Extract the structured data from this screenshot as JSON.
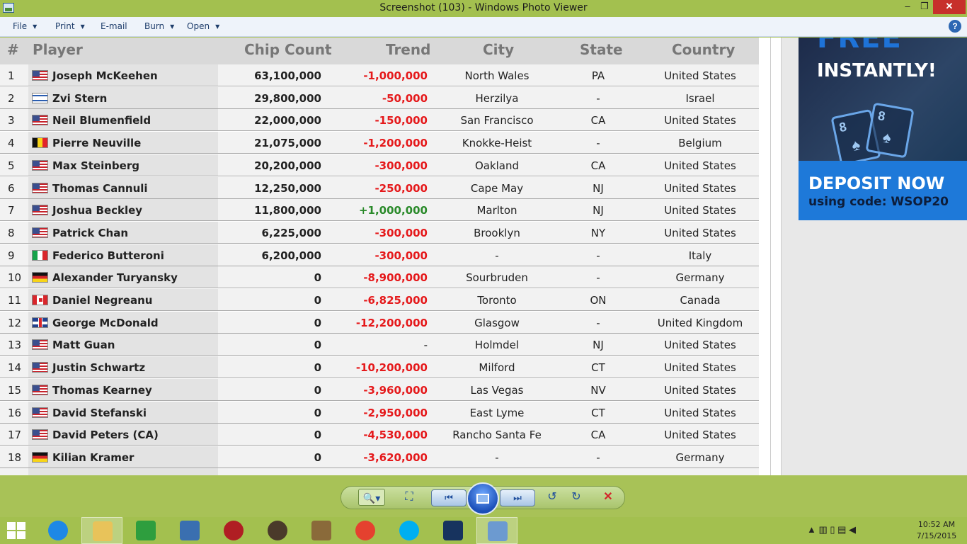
{
  "window": {
    "title": "Screenshot (103) - Windows Photo Viewer",
    "min_glyph": "–",
    "max_glyph": "❐",
    "close_glyph": "✕"
  },
  "menu": {
    "file": "File",
    "print": "Print",
    "email": "E-mail",
    "burn": "Burn",
    "open": "Open",
    "caret": "▼",
    "help": "?"
  },
  "table": {
    "headers": {
      "rank": "#",
      "player": "Player",
      "chips": "Chip Count",
      "trend": "Trend",
      "city": "City",
      "state": "State",
      "country": "Country"
    },
    "rows": [
      {
        "rank": "1",
        "flag": "us",
        "player": "Joseph McKeehen",
        "chips": "63,100,000",
        "trend": "-1,000,000",
        "trend_type": "neg",
        "city": "North Wales",
        "state": "PA",
        "country": "United States"
      },
      {
        "rank": "2",
        "flag": "il",
        "player": "Zvi Stern",
        "chips": "29,800,000",
        "trend": "-50,000",
        "trend_type": "neg",
        "city": "Herzilya",
        "state": "-",
        "country": "Israel"
      },
      {
        "rank": "3",
        "flag": "us",
        "player": "Neil Blumenfield",
        "chips": "22,000,000",
        "trend": "-150,000",
        "trend_type": "neg",
        "city": "San Francisco",
        "state": "CA",
        "country": "United States"
      },
      {
        "rank": "4",
        "flag": "be",
        "player": "Pierre Neuville",
        "chips": "21,075,000",
        "trend": "-1,200,000",
        "trend_type": "neg",
        "city": "Knokke-Heist",
        "state": "-",
        "country": "Belgium"
      },
      {
        "rank": "5",
        "flag": "us",
        "player": "Max Steinberg",
        "chips": "20,200,000",
        "trend": "-300,000",
        "trend_type": "neg",
        "city": "Oakland",
        "state": "CA",
        "country": "United States"
      },
      {
        "rank": "6",
        "flag": "us",
        "player": "Thomas Cannuli",
        "chips": "12,250,000",
        "trend": "-250,000",
        "trend_type": "neg",
        "city": "Cape May",
        "state": "NJ",
        "country": "United States"
      },
      {
        "rank": "7",
        "flag": "us",
        "player": "Joshua Beckley",
        "chips": "11,800,000",
        "trend": "+1,000,000",
        "trend_type": "pos",
        "city": "Marlton",
        "state": "NJ",
        "country": "United States"
      },
      {
        "rank": "8",
        "flag": "us",
        "player": "Patrick Chan",
        "chips": "6,225,000",
        "trend": "-300,000",
        "trend_type": "neg",
        "city": "Brooklyn",
        "state": "NY",
        "country": "United States"
      },
      {
        "rank": "9",
        "flag": "it",
        "player": "Federico Butteroni",
        "chips": "6,200,000",
        "trend": "-300,000",
        "trend_type": "neg",
        "city": "-",
        "state": "-",
        "country": "Italy"
      },
      {
        "rank": "10",
        "flag": "de",
        "player": "Alexander Turyansky",
        "chips": "0",
        "trend": "-8,900,000",
        "trend_type": "neg",
        "city": "Sourbruden",
        "state": "-",
        "country": "Germany"
      },
      {
        "rank": "11",
        "flag": "ca",
        "player": "Daniel Negreanu",
        "chips": "0",
        "trend": "-6,825,000",
        "trend_type": "neg",
        "city": "Toronto",
        "state": "ON",
        "country": "Canada"
      },
      {
        "rank": "12",
        "flag": "uk",
        "player": "George McDonald",
        "chips": "0",
        "trend": "-12,200,000",
        "trend_type": "neg",
        "city": "Glasgow",
        "state": "-",
        "country": "United Kingdom"
      },
      {
        "rank": "13",
        "flag": "us",
        "player": "Matt Guan",
        "chips": "0",
        "trend": "-",
        "trend_type": "none",
        "city": "Holmdel",
        "state": "NJ",
        "country": "United States"
      },
      {
        "rank": "14",
        "flag": "us",
        "player": "Justin Schwartz",
        "chips": "0",
        "trend": "-10,200,000",
        "trend_type": "neg",
        "city": "Milford",
        "state": "CT",
        "country": "United States"
      },
      {
        "rank": "15",
        "flag": "us",
        "player": "Thomas Kearney",
        "chips": "0",
        "trend": "-3,960,000",
        "trend_type": "neg",
        "city": "Las Vegas",
        "state": "NV",
        "country": "United States"
      },
      {
        "rank": "16",
        "flag": "us",
        "player": "David Stefanski",
        "chips": "0",
        "trend": "-2,950,000",
        "trend_type": "neg",
        "city": "East Lyme",
        "state": "CT",
        "country": "United States"
      },
      {
        "rank": "17",
        "flag": "us",
        "player": "David Peters (CA)",
        "chips": "0",
        "trend": "-4,530,000",
        "trend_type": "neg",
        "city": "Rancho Santa Fe",
        "state": "CA",
        "country": "United States"
      },
      {
        "rank": "18",
        "flag": "de",
        "player": "Kilian Kramer",
        "chips": "0",
        "trend": "-3,620,000",
        "trend_type": "neg",
        "city": "-",
        "state": "-",
        "country": "Germany"
      }
    ]
  },
  "ad": {
    "free": "FREE",
    "instantly": "INSTANTLY!",
    "card1_rank": "8",
    "card2_rank": "8",
    "card1_suit": "♠",
    "card2_suit": "♠",
    "deposit": "DEPOSIT NOW",
    "code": "using code: WSOP20"
  },
  "viewer_toolbar": {
    "zoom": "🔍▾",
    "fit": "⛶",
    "prev": "⏮",
    "next": "⏭",
    "rotate_ccw": "↺",
    "rotate_cw": "↻",
    "delete": "✕"
  },
  "taskbar": {
    "tray": "▲  ▥  ▯  ▤  ◀",
    "time": "10:52 AM",
    "date": "7/15/2015",
    "icons": [
      {
        "name": "ie",
        "color": "#1e88e5"
      },
      {
        "name": "file-explorer",
        "color": "#e8c35a"
      },
      {
        "name": "store",
        "color": "#2e9e3e"
      },
      {
        "name": "control-panel",
        "color": "#3a6fb0"
      },
      {
        "name": "power",
        "color": "#b01e23"
      },
      {
        "name": "speaker",
        "color": "#4a3a2a"
      },
      {
        "name": "doc-viewer",
        "color": "#8a6a3a"
      },
      {
        "name": "chrome",
        "color": "#e5412f"
      },
      {
        "name": "skype",
        "color": "#00aff0"
      },
      {
        "name": "william-hill",
        "color": "#17335e"
      },
      {
        "name": "photo-viewer",
        "color": "#6c9ad0"
      }
    ]
  }
}
